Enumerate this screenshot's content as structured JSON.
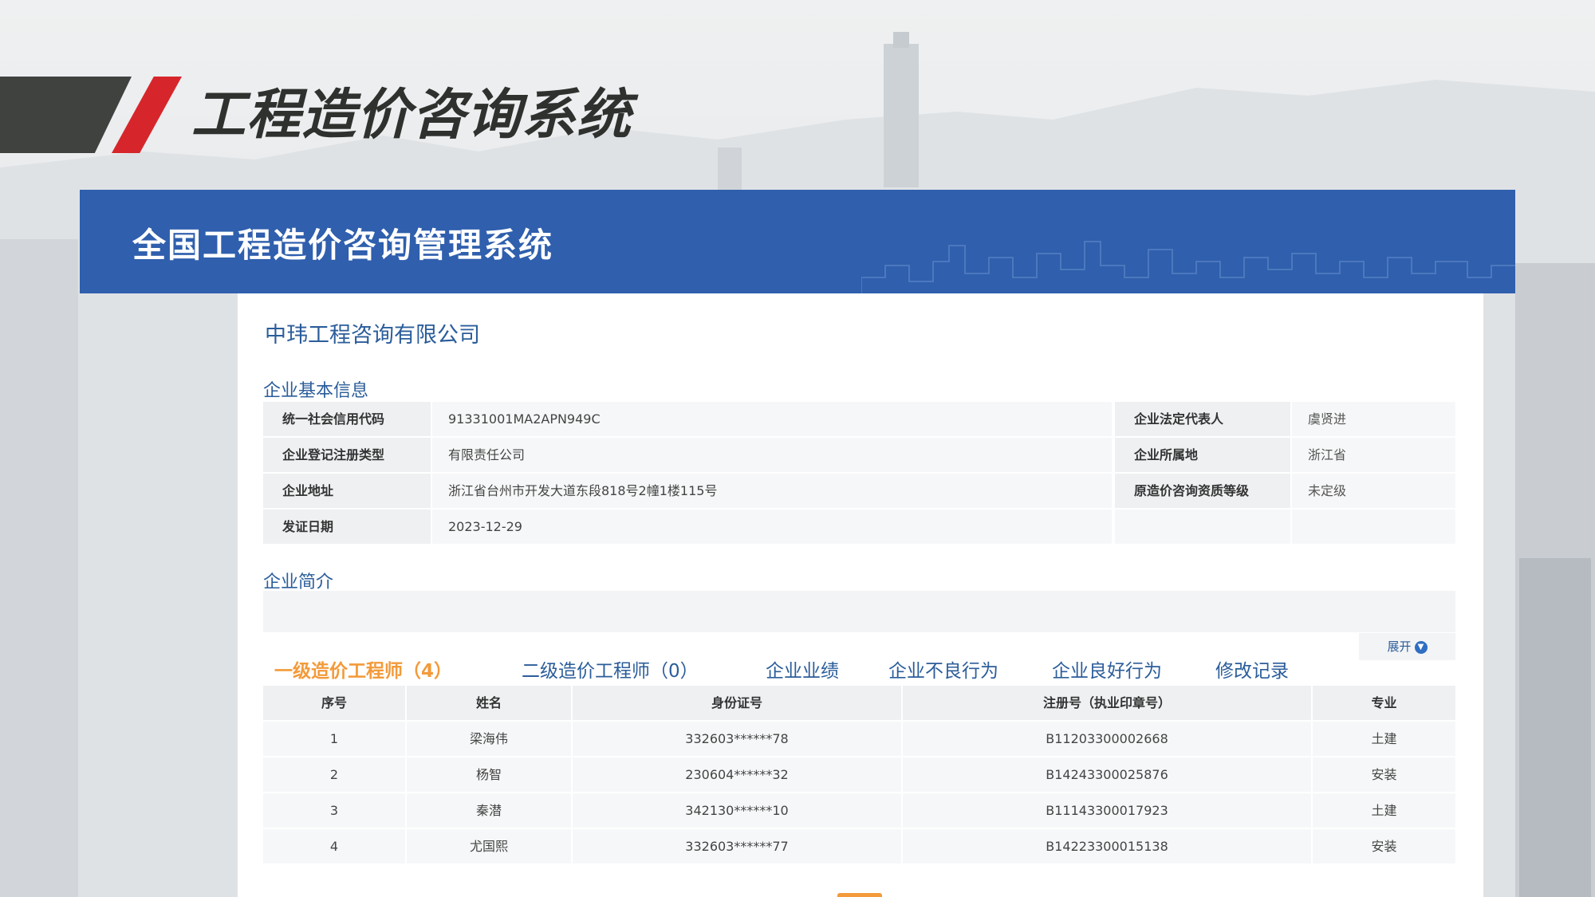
{
  "slide": {
    "title": "工程造价咨询系统"
  },
  "app": {
    "title": "全国工程造价咨询管理系统"
  },
  "company": {
    "name": "中玮工程咨询有限公司"
  },
  "sections": {
    "basic_info": "企业基本信息",
    "intro": "企业简介"
  },
  "basic_info": [
    {
      "label1": "统一社会信用代码",
      "value1": "91331001MA2APN949C",
      "label2": "企业法定代表人",
      "value2": "虞贤进"
    },
    {
      "label1": "企业登记注册类型",
      "value1": "有限责任公司",
      "label2": "企业所属地",
      "value2": "浙江省"
    },
    {
      "label1": "企业地址",
      "value1": "浙江省台州市开发大道东段818号2幢1楼115号",
      "label2": "原造价咨询资质等级",
      "value2": "未定级"
    },
    {
      "label1": "发证日期",
      "value1": "2023-12-29",
      "label2": "",
      "value2": ""
    }
  ],
  "expand": {
    "label": "展开",
    "icon": "chevron-down-icon"
  },
  "tabs": [
    {
      "label": "一级造价工程师（4）",
      "active": true
    },
    {
      "label": "二级造价工程师（0）",
      "active": false
    },
    {
      "label": "企业业绩",
      "active": false
    },
    {
      "label": "企业不良行为",
      "active": false
    },
    {
      "label": "企业良好行为",
      "active": false
    },
    {
      "label": "修改记录",
      "active": false
    }
  ],
  "engineers_table": {
    "headers": [
      "序号",
      "姓名",
      "身份证号",
      "注册号（执业印章号）",
      "专业"
    ],
    "rows": [
      [
        "1",
        "梁海伟",
        "332603******78",
        "B11203300002668",
        "土建"
      ],
      [
        "2",
        "杨智",
        "230604******32",
        "B14243300025876",
        "安装"
      ],
      [
        "3",
        "秦潜",
        "342130******10",
        "B11143300017923",
        "土建"
      ],
      [
        "4",
        "尤国熙",
        "332603******77",
        "B14223300015138",
        "安装"
      ]
    ]
  },
  "colors": {
    "header_blue": "#2f5fad",
    "link_blue": "#2b5d9a",
    "active_orange": "#f39a3a",
    "accent_red": "#d6262b"
  }
}
